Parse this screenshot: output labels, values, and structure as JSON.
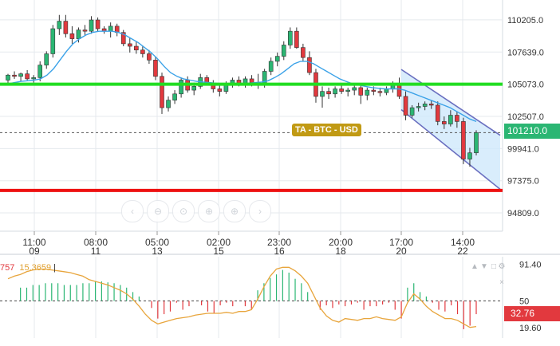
{
  "chart_data": [
    {
      "type": "candlestick",
      "symbol_label": "TA - BTC - USD",
      "current_price_label": "101210.0",
      "price_axis_ticks": [
        110205.0,
        107639.0,
        105073.0,
        102507.0,
        99941.0,
        97375.0,
        94809.0
      ],
      "price_axis_labels": [
        "110205.0",
        "107639.0",
        "105073.0",
        "102507.0",
        "99941.0",
        "97375.0",
        "94809.0"
      ],
      "ylim": [
        93350,
        111790
      ],
      "time_axis": [
        {
          "time": "11:00",
          "day": "09"
        },
        {
          "time": "08:00",
          "day": "11"
        },
        {
          "time": "05:00",
          "day": "13"
        },
        {
          "time": "02:00",
          "day": "15"
        },
        {
          "time": "23:00",
          "day": "16"
        },
        {
          "time": "20:00",
          "day": "18"
        },
        {
          "time": "17:00",
          "day": "20"
        },
        {
          "time": "14:00",
          "day": "22"
        }
      ],
      "candles": [
        {
          "o": 105400,
          "h": 105900,
          "l": 105100,
          "c": 105800
        },
        {
          "o": 105800,
          "h": 106100,
          "l": 105500,
          "c": 105700
        },
        {
          "o": 105700,
          "h": 106000,
          "l": 105300,
          "c": 105900
        },
        {
          "o": 105900,
          "h": 106200,
          "l": 105400,
          "c": 105500
        },
        {
          "o": 105500,
          "h": 105800,
          "l": 105200,
          "c": 105600
        },
        {
          "o": 105600,
          "h": 106900,
          "l": 105300,
          "c": 106600
        },
        {
          "o": 106600,
          "h": 107700,
          "l": 106300,
          "c": 107500
        },
        {
          "o": 107500,
          "h": 109800,
          "l": 107200,
          "c": 109500
        },
        {
          "o": 109500,
          "h": 110600,
          "l": 109000,
          "c": 110100
        },
        {
          "o": 110100,
          "h": 110600,
          "l": 108800,
          "c": 109100
        },
        {
          "o": 109100,
          "h": 109700,
          "l": 108300,
          "c": 108700
        },
        {
          "o": 108700,
          "h": 109600,
          "l": 108400,
          "c": 109400
        },
        {
          "o": 109400,
          "h": 109800,
          "l": 109000,
          "c": 109300
        },
        {
          "o": 109300,
          "h": 110500,
          "l": 109100,
          "c": 110200
        },
        {
          "o": 110200,
          "h": 110400,
          "l": 109300,
          "c": 109500
        },
        {
          "o": 109500,
          "h": 109700,
          "l": 109100,
          "c": 109300
        },
        {
          "o": 109300,
          "h": 110000,
          "l": 108800,
          "c": 109700
        },
        {
          "o": 109700,
          "h": 109900,
          "l": 108900,
          "c": 109200
        },
        {
          "o": 109200,
          "h": 109400,
          "l": 108100,
          "c": 108300
        },
        {
          "o": 108300,
          "h": 108800,
          "l": 107600,
          "c": 108100
        },
        {
          "o": 108100,
          "h": 108500,
          "l": 107500,
          "c": 107800
        },
        {
          "o": 107800,
          "h": 108100,
          "l": 107200,
          "c": 107500
        },
        {
          "o": 107500,
          "h": 107800,
          "l": 106700,
          "c": 107000
        },
        {
          "o": 107000,
          "h": 107300,
          "l": 105400,
          "c": 105700
        },
        {
          "o": 105700,
          "h": 106000,
          "l": 102700,
          "c": 103200
        },
        {
          "o": 103200,
          "h": 104100,
          "l": 102900,
          "c": 103800
        },
        {
          "o": 103800,
          "h": 104600,
          "l": 103500,
          "c": 104300
        },
        {
          "o": 104300,
          "h": 105600,
          "l": 104000,
          "c": 105400
        },
        {
          "o": 105400,
          "h": 105700,
          "l": 104400,
          "c": 104600
        },
        {
          "o": 104600,
          "h": 105200,
          "l": 104200,
          "c": 104900
        },
        {
          "o": 104900,
          "h": 105900,
          "l": 104700,
          "c": 105600
        },
        {
          "o": 105600,
          "h": 105800,
          "l": 105000,
          "c": 105100
        },
        {
          "o": 105100,
          "h": 105400,
          "l": 104400,
          "c": 104700
        },
        {
          "o": 104700,
          "h": 105000,
          "l": 104100,
          "c": 104500
        },
        {
          "o": 104500,
          "h": 105300,
          "l": 104300,
          "c": 105100
        },
        {
          "o": 105100,
          "h": 105600,
          "l": 104800,
          "c": 105400
        },
        {
          "o": 105400,
          "h": 105700,
          "l": 104900,
          "c": 105100
        },
        {
          "o": 105100,
          "h": 105700,
          "l": 104800,
          "c": 105500
        },
        {
          "o": 105500,
          "h": 105800,
          "l": 104900,
          "c": 105200
        },
        {
          "o": 105200,
          "h": 105900,
          "l": 104700,
          "c": 105000
        },
        {
          "o": 105000,
          "h": 106300,
          "l": 104800,
          "c": 106100
        },
        {
          "o": 106100,
          "h": 107200,
          "l": 105800,
          "c": 106900
        },
        {
          "o": 106900,
          "h": 107600,
          "l": 106500,
          "c": 107300
        },
        {
          "o": 107300,
          "h": 108500,
          "l": 107000,
          "c": 108200
        },
        {
          "o": 108200,
          "h": 109600,
          "l": 107900,
          "c": 109300
        },
        {
          "o": 109300,
          "h": 109600,
          "l": 107900,
          "c": 108000
        },
        {
          "o": 108000,
          "h": 108300,
          "l": 106900,
          "c": 107200
        },
        {
          "o": 107200,
          "h": 107700,
          "l": 105800,
          "c": 106000
        },
        {
          "o": 106000,
          "h": 106300,
          "l": 103600,
          "c": 104100
        },
        {
          "o": 104100,
          "h": 104900,
          "l": 103200,
          "c": 104500
        },
        {
          "o": 104500,
          "h": 104800,
          "l": 103900,
          "c": 104300
        },
        {
          "o": 104300,
          "h": 104900,
          "l": 104000,
          "c": 104700
        },
        {
          "o": 104700,
          "h": 105000,
          "l": 104300,
          "c": 104500
        },
        {
          "o": 104500,
          "h": 104800,
          "l": 104100,
          "c": 104600
        },
        {
          "o": 104600,
          "h": 105100,
          "l": 104200,
          "c": 104800
        },
        {
          "o": 104800,
          "h": 105000,
          "l": 103500,
          "c": 104200
        },
        {
          "o": 104200,
          "h": 104800,
          "l": 103800,
          "c": 104600
        },
        {
          "o": 104600,
          "h": 104900,
          "l": 104200,
          "c": 104500
        },
        {
          "o": 104500,
          "h": 104800,
          "l": 104100,
          "c": 104400
        },
        {
          "o": 104400,
          "h": 104900,
          "l": 104200,
          "c": 104700
        },
        {
          "o": 104700,
          "h": 105300,
          "l": 104400,
          "c": 105000
        },
        {
          "o": 105000,
          "h": 105600,
          "l": 103900,
          "c": 104100
        },
        {
          "o": 104100,
          "h": 104500,
          "l": 102200,
          "c": 102600
        },
        {
          "o": 102600,
          "h": 103400,
          "l": 102400,
          "c": 103200
        },
        {
          "o": 103200,
          "h": 103600,
          "l": 102900,
          "c": 103300
        },
        {
          "o": 103300,
          "h": 103700,
          "l": 103000,
          "c": 103500
        },
        {
          "o": 103500,
          "h": 103800,
          "l": 103100,
          "c": 103400
        },
        {
          "o": 103400,
          "h": 103700,
          "l": 101800,
          "c": 102100
        },
        {
          "o": 102100,
          "h": 102500,
          "l": 101500,
          "c": 101900
        },
        {
          "o": 101900,
          "h": 103000,
          "l": 101700,
          "c": 102600
        },
        {
          "o": 102600,
          "h": 102900,
          "l": 101600,
          "c": 102100
        },
        {
          "o": 102100,
          "h": 102400,
          "l": 98700,
          "c": 99100
        },
        {
          "o": 99100,
          "h": 100000,
          "l": 98500,
          "c": 99600
        },
        {
          "o": 99600,
          "h": 101400,
          "l": 99400,
          "c": 101210
        }
      ],
      "moving_average": [
        105100,
        105200,
        105300,
        105350,
        105400,
        105500,
        105800,
        106300,
        107000,
        107700,
        108300,
        108700,
        109000,
        109200,
        109300,
        109300,
        109300,
        109200,
        109000,
        108700,
        108400,
        108000,
        107600,
        107100,
        106500,
        106000,
        105700,
        105500,
        105400,
        105300,
        105250,
        105200,
        105150,
        105100,
        105100,
        105100,
        105100,
        105150,
        105200,
        105250,
        105350,
        105600,
        105900,
        106300,
        106700,
        106900,
        106900,
        106700,
        106400,
        106100,
        105800,
        105500,
        105300,
        105100,
        105000,
        104900,
        104800,
        104750,
        104700,
        104700,
        104700,
        104600,
        104400,
        104200,
        104000,
        103800,
        103600,
        103400,
        103200,
        102900,
        102600,
        102300,
        102100
      ],
      "support_line": 105073,
      "resistance_line": 96600,
      "channel": {
        "upper": [
          106250,
          101000
        ],
        "lower": [
          103050,
          96700
        ]
      },
      "dashed_reference": 101210
    },
    {
      "type": "bar",
      "legend_value_1": "757",
      "legend_value_2": "15.3659",
      "current_value_label": "32.76",
      "axis_ticks": [
        91.4,
        50,
        19.6
      ],
      "axis_labels": [
        "91.40",
        "50",
        "19.60"
      ],
      "ylim": [
        8,
        100
      ],
      "midline": 50,
      "histogram": [
        50,
        50,
        65,
        65,
        68,
        68,
        70,
        70,
        70,
        68,
        68,
        68,
        70,
        70,
        72,
        72,
        71,
        70,
        68,
        65,
        60,
        55,
        50,
        42,
        30,
        35,
        38,
        48,
        40,
        44,
        50,
        45,
        38,
        36,
        45,
        48,
        44,
        50,
        44,
        40,
        62,
        70,
        76,
        80,
        85,
        82,
        75,
        70,
        60,
        50,
        40,
        45,
        42,
        46,
        44,
        46,
        48,
        40,
        44,
        44,
        46,
        48,
        40,
        30,
        65,
        70,
        60,
        55,
        48,
        40,
        38,
        45,
        35,
        18,
        22,
        35
      ],
      "oscillator": [
        75,
        78,
        80,
        83,
        85,
        86,
        86,
        85,
        84,
        83,
        82,
        80,
        78,
        74,
        72,
        70,
        68,
        65,
        62,
        58,
        52,
        44,
        35,
        28,
        24,
        26,
        28,
        30,
        31,
        32,
        34,
        35,
        36,
        36,
        36,
        37,
        36,
        38,
        38,
        40,
        52,
        66,
        78,
        86,
        88,
        88,
        84,
        78,
        70,
        56,
        42,
        33,
        28,
        26,
        30,
        29,
        28,
        30,
        30,
        32,
        30,
        29,
        28,
        32,
        48,
        58,
        52,
        44,
        38,
        34,
        30,
        30,
        28,
        24,
        20,
        21
      ]
    }
  ],
  "toolbar": {
    "buttons": [
      {
        "name": "pan-left-button",
        "icon": "chevron-left-icon",
        "glyph": "‹"
      },
      {
        "name": "zoom-out-button",
        "icon": "magnifier-minus-icon",
        "glyph": "⊖"
      },
      {
        "name": "reset-zoom-button",
        "icon": "magnifier-reset-icon",
        "glyph": "⊙"
      },
      {
        "name": "zoom-in-button",
        "icon": "magnifier-plus-icon",
        "glyph": "⊕"
      },
      {
        "name": "zoom-fit-button",
        "icon": "magnifier-fit-icon",
        "glyph": "⊕"
      },
      {
        "name": "pan-right-button",
        "icon": "chevron-right-icon",
        "glyph": "›"
      }
    ]
  },
  "indicator_icons": [
    {
      "name": "indicator-up-icon",
      "glyph": "▲"
    },
    {
      "name": "indicator-down-icon",
      "glyph": "▼"
    },
    {
      "name": "indicator-maximize-icon",
      "glyph": "□"
    },
    {
      "name": "indicator-settings-icon",
      "glyph": "⚙"
    },
    {
      "name": "indicator-close-icon",
      "glyph": "×"
    }
  ],
  "colors": {
    "bull": "#2bb673",
    "bear": "#e2393e",
    "support": "#22dd22",
    "resistance": "#ee1111",
    "ma": "#3ba2e8",
    "channel_fill": "#cfe8fb",
    "channel_line": "#6a6fc0",
    "oscillator": "#e8a53c",
    "label_bg": "#c19a14",
    "grid": "#e5e9ee",
    "axis_text": "#333333"
  }
}
